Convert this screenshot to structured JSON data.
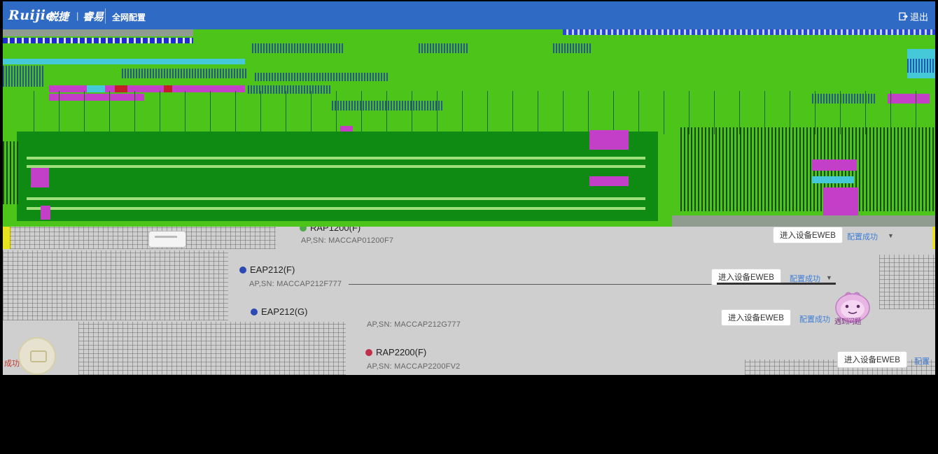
{
  "header": {
    "logo_text": "Ruijie",
    "logo_cn": "锐捷",
    "sep": "|",
    "logo_sub": "睿易",
    "nav_title": "全网配置",
    "logout_label": "退出",
    "background": "#2f6ac4",
    "logout_icon": "logout-icon"
  },
  "devices": [
    {
      "name": "RAP1200(F)",
      "sn_label": "AP,SN:",
      "sn": "MACCAP01200F7",
      "status_color": "#4fa84a",
      "button": "进入设备EWEB",
      "status": "配置成功"
    },
    {
      "name": "EAP212(F)",
      "sn_label": "AP,SN:",
      "sn": "MACCAP212F777",
      "status_color": "#2b4ab3",
      "button": "进入设备EWEB",
      "status": "配置成功"
    },
    {
      "name": "EAP212(G)",
      "sn_label": "AP,SN:",
      "sn": "MACCAP212G777",
      "status_color": "#2b4ab3",
      "button": "进入设备EWEB",
      "status": "配置成功"
    },
    {
      "name": "RAP2200(F)",
      "sn_label": "AP,SN:",
      "sn": "MACCAP2200FV2",
      "status_color": "#c0304a",
      "button": "进入设备EWEB",
      "status": "配置"
    }
  ],
  "side": {
    "left_status": "成功",
    "help_label": "遇到问题"
  },
  "colors": {
    "green_artifact": "#4cc41a",
    "panel_gray": "#cfcfcf",
    "link_blue": "#3f7fd6"
  }
}
